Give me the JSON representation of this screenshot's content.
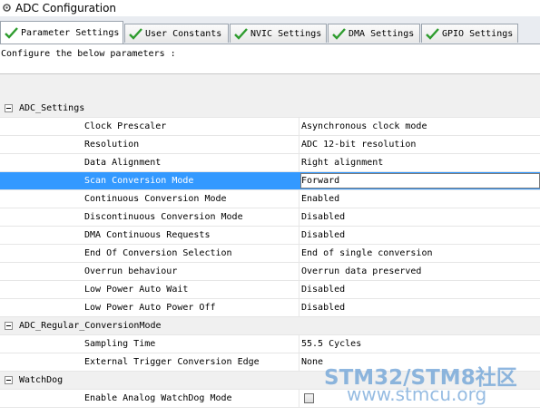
{
  "window": {
    "title": "ADC Configuration"
  },
  "tabs": [
    {
      "label": "Parameter Settings",
      "active": true
    },
    {
      "label": "User Constants",
      "active": false
    },
    {
      "label": "NVIC Settings",
      "active": false
    },
    {
      "label": "DMA Settings",
      "active": false
    },
    {
      "label": "GPIO Settings",
      "active": false
    }
  ],
  "intro_text": "Configure the below parameters :",
  "groups": {
    "adc_settings": {
      "name": "ADC_Settings",
      "params": [
        {
          "name": "Clock Prescaler",
          "value": "Asynchronous clock mode"
        },
        {
          "name": "Resolution",
          "value": "ADC 12-bit resolution"
        },
        {
          "name": "Data Alignment",
          "value": "Right alignment"
        },
        {
          "name": "Scan Conversion Mode",
          "value": "Forward"
        },
        {
          "name": "Continuous Conversion Mode",
          "value": "Enabled"
        },
        {
          "name": "Discontinuous Conversion Mode",
          "value": "Disabled"
        },
        {
          "name": "DMA Continuous Requests",
          "value": "Disabled"
        },
        {
          "name": "End Of Conversion Selection",
          "value": "End of single conversion"
        },
        {
          "name": "Overrun behaviour",
          "value": "Overrun data preserved"
        },
        {
          "name": "Low Power Auto Wait",
          "value": "Disabled"
        },
        {
          "name": "Low Power Auto Power Off",
          "value": "Disabled"
        }
      ]
    },
    "regular_conversion": {
      "name": "ADC_Regular_ConversionMode",
      "params": [
        {
          "name": "Sampling Time",
          "value": "55.5 Cycles"
        },
        {
          "name": "External Trigger Conversion Edge",
          "value": "None"
        }
      ]
    },
    "watchdog": {
      "name": "WatchDog",
      "params": [
        {
          "name": "Enable Analog WatchDog Mode",
          "checked": false
        }
      ]
    }
  },
  "watermark": {
    "line1": "STM32/STM8社区",
    "line2": "www.stmcu.org"
  },
  "colors": {
    "selection": "#3399ff",
    "check_green": "#2e9c2e",
    "watermark": "#6aa0d6"
  }
}
